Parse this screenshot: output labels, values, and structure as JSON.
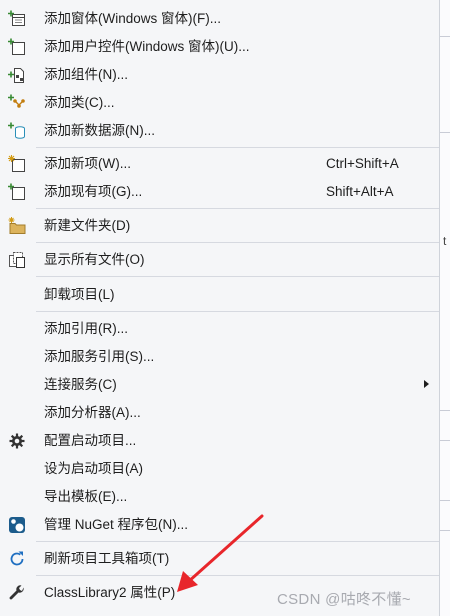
{
  "menu": {
    "items": [
      {
        "id": "add-window",
        "label": "添加窗体(Windows 窗体)(F)...",
        "icon": "add-window-icon"
      },
      {
        "id": "add-user-control",
        "label": "添加用户控件(Windows 窗体)(U)...",
        "icon": "add-user-control-icon"
      },
      {
        "id": "add-component",
        "label": "添加组件(N)...",
        "icon": "add-component-icon"
      },
      {
        "id": "add-class",
        "label": "添加类(C)...",
        "icon": "add-class-icon"
      },
      {
        "id": "add-data-source",
        "label": "添加新数据源(N)...",
        "icon": "add-data-source-icon"
      },
      {
        "id": "add-new-item",
        "label": "添加新项(W)...",
        "shortcut": "Ctrl+Shift+A",
        "icon": "add-new-item-icon"
      },
      {
        "id": "add-existing-item",
        "label": "添加现有项(G)...",
        "shortcut": "Shift+Alt+A",
        "icon": "add-existing-item-icon"
      },
      {
        "id": "new-folder",
        "label": "新建文件夹(D)",
        "icon": "new-folder-icon"
      },
      {
        "id": "show-all-files",
        "label": "显示所有文件(O)",
        "icon": "show-all-files-icon"
      },
      {
        "id": "unload-project",
        "label": "卸载项目(L)"
      },
      {
        "id": "add-reference",
        "label": "添加引用(R)..."
      },
      {
        "id": "add-service-reference",
        "label": "添加服务引用(S)..."
      },
      {
        "id": "connected-services",
        "label": "连接服务(C)",
        "submenu": true
      },
      {
        "id": "add-analyzer",
        "label": "添加分析器(A)..."
      },
      {
        "id": "configure-startup",
        "label": "配置启动项目...",
        "icon": "gear-icon"
      },
      {
        "id": "set-startup",
        "label": "设为启动项目(A)"
      },
      {
        "id": "export-template",
        "label": "导出模板(E)..."
      },
      {
        "id": "manage-nuget",
        "label": "管理 NuGet 程序包(N)...",
        "icon": "nuget-icon"
      },
      {
        "id": "refresh-toolbox",
        "label": "刷新项目工具箱项(T)",
        "icon": "refresh-icon"
      },
      {
        "id": "properties",
        "label": "ClassLibrary2 属性(P)",
        "icon": "wrench-icon"
      }
    ]
  },
  "watermark": "CSDN @咕咚不懂~",
  "background": {
    "fragment_1": "",
    "fragment_2": "t"
  },
  "colors": {
    "accent": "#1f5fbf",
    "annotation_arrow": "#e8262b"
  }
}
